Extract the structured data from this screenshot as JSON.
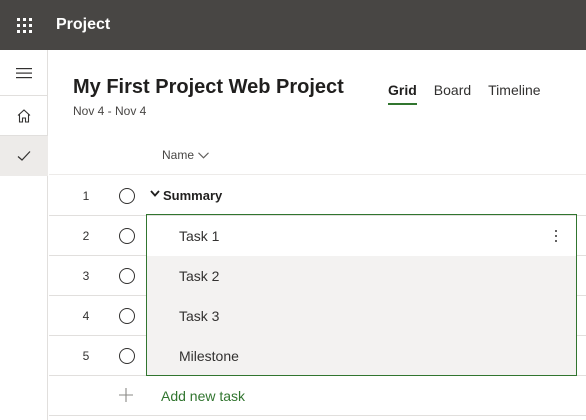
{
  "app": {
    "name": "Project"
  },
  "project": {
    "title": "My First Project Web Project",
    "date_range": "Nov 4 - Nov 4"
  },
  "views": [
    {
      "label": "Grid",
      "active": true
    },
    {
      "label": "Board",
      "active": false
    },
    {
      "label": "Timeline",
      "active": false
    }
  ],
  "grid": {
    "column_header": "Name",
    "rows": [
      {
        "num": "1",
        "name": "Summary",
        "type": "summary"
      },
      {
        "num": "2",
        "name": "Task 1",
        "type": "task"
      },
      {
        "num": "3",
        "name": "Task 2",
        "type": "task"
      },
      {
        "num": "4",
        "name": "Task 3",
        "type": "task"
      },
      {
        "num": "5",
        "name": "Milestone",
        "type": "task"
      }
    ],
    "add_task_label": "Add new task"
  },
  "colors": {
    "suite_bar": "#484644",
    "accent": "#31752f",
    "selected_cell": "#f3f2f1"
  },
  "icons": [
    "waffle-icon",
    "hamburger-icon",
    "home-icon",
    "checkmark-icon",
    "chevron-down-icon",
    "more-vertical-icon",
    "plus-icon"
  ]
}
